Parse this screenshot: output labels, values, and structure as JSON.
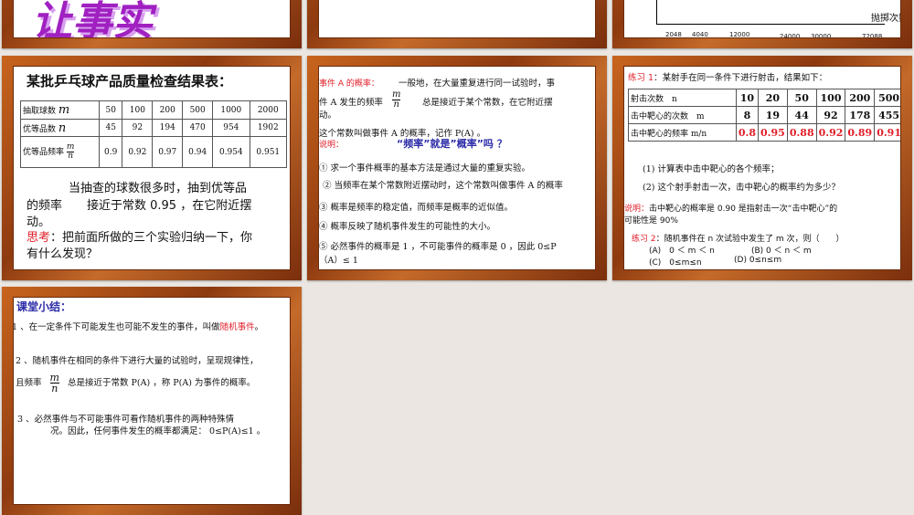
{
  "slide1": {
    "title_fragment": "让事实"
  },
  "slide3": {
    "ticks": [
      "2048",
      "4040",
      "12000",
      "24000",
      "30000",
      "72088"
    ],
    "axis_label": "抛掷次数 n"
  },
  "slide4": {
    "title": "某批乒乓球产品质量检查结果表：",
    "rows": [
      {
        "label": "抽取球数",
        "var": "m",
        "values": [
          "50",
          "100",
          "200",
          "500",
          "1000",
          "2000"
        ]
      },
      {
        "label": "优等品数",
        "var": "n",
        "values": [
          "45",
          "92",
          "194",
          "470",
          "954",
          "1902"
        ]
      },
      {
        "label": "优等品频率",
        "var": "m/n",
        "values": [
          "0.9",
          "0.92",
          "0.97",
          "0.94",
          "0.954",
          "0.951"
        ]
      }
    ],
    "frac_num": "m",
    "frac_den": "n",
    "text1": "当抽查的球数很多时，抽到优等品",
    "text2a": "的频率",
    "text2b": "接近于常数 0.95 ，在它附近摆",
    "text3": "动。",
    "think_label": "思考",
    "think_text": "：把前面所做的三个实验归纳一下，你",
    "think_text2": "有什么发现？"
  },
  "slide5": {
    "def_label": "事件 A 的概率：",
    "def1": "一般地，在大量重复进行同一试验时，事",
    "def2a": "件 A 发生的频率",
    "def2b": "总是接近于某个常数，在它附近摆",
    "def3": "动。",
    "def4": "这个常数叫做事件 A 的概率，记作 P(A) 。",
    "note_label": "说明：",
    "question": "“频率”就是”概率”吗 ？",
    "points": [
      "① 求一个事件概率的基本方法是通过大量的重复实验。",
      "② 当频率在某个常数附近摆动时，这个常数叫做事件 A 的概率",
      "③ 概率是频率的稳定值，而频率是概率的近似值。",
      "④ 概率反映了随机事件发生的可能性的大小。",
      "⑤ 必然事件的概率是 1 ，不可能事件的概率是 0 ，因此 0≤P",
      "（A）≤ 1"
    ]
  },
  "slide6": {
    "ex1_label": "练习 1",
    "ex1_text": "：某射手在同一条件下进行射击，结果如下：",
    "rows": [
      {
        "label": "射击次数　n",
        "values": [
          "10",
          "20",
          "50",
          "100",
          "200",
          "500"
        ]
      },
      {
        "label": "击中靶心的次数　m",
        "values": [
          "8",
          "19",
          "44",
          "92",
          "178",
          "455"
        ]
      },
      {
        "label": "击中靶心的频率 m/n",
        "values": [
          "0.8",
          "0.95",
          "0.88",
          "0.92",
          "0.89",
          "0.91"
        ]
      }
    ],
    "q1": "(1) 计算表中击中靶心的各个频率；",
    "q2": "(2) 这个射手射击一次，击中靶心的概率约为多少？",
    "note_label": "说明：",
    "note1": "击中靶心的概率是 0.90 是指射击一次“击中靶心”的",
    "note2": "可能性是 90%",
    "ex2_label": "练习 2",
    "ex2_text": "：随机事件在 n 次试验中发生了 m 次，则（　　）",
    "optA": "(A)　0 ＜ m ＜ n",
    "optB": "(B) 0 ＜ n ＜ m",
    "optC": "(C)　0≤m≤n",
    "optD": "(D) 0≤n≤m"
  },
  "slide7": {
    "title": "课堂小结：",
    "p1a": "1 、在一定条件下可能发生也可能不发生的事件，叫做",
    "p1b": "随机事件",
    "p1c": "。",
    "p2a": "2 、随机事件在相同的条件下进行大量的试验时，呈现规律性，",
    "p2b": "且频率",
    "p2c": "总是接近于常数 P(A) ，称 P(A) 为事件的概率。",
    "p3a": "3 、必然事件与不可能事件可看作随机事件的两种特殊情",
    "p3b": "况。因此，任何事件发生的概率都满足：  0≤P(A)≤1 。"
  }
}
